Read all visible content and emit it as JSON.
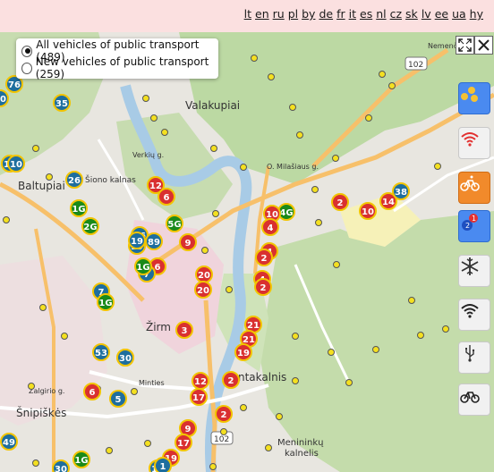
{
  "languages": [
    "lt",
    "en",
    "ru",
    "pl",
    "by",
    "de",
    "fr",
    "it",
    "es",
    "nl",
    "cz",
    "sk",
    "lv",
    "ee",
    "ua",
    "hy"
  ],
  "filters": {
    "all_label": "All vehicles of public transport (489)",
    "new_label": "New vehicles of public transport (259)",
    "selected": "all"
  },
  "map_labels": {
    "valakupiai": "Valakupiai",
    "baltupiai": "Baltupiai",
    "siono_kalnas": "Šiono kalnas",
    "zirmunai": "Žirm",
    "antakalnis": "ntakalnis",
    "snipiskes": "Šnipiškės",
    "menininku_1": "Menininkų",
    "menininku_2": "kalnelis",
    "zalgirio": "Žalgirio g.",
    "mintes": "Minties",
    "o_milasiaus": "O. Milašiaus g.",
    "road_102_a": "102",
    "road_102_b": "102",
    "nemenc": "Nemenč",
    "verkiu": "Verkių g."
  },
  "side_buttons": [
    {
      "name": "routes-button",
      "icon": "routes-icon",
      "style": "blue"
    },
    {
      "name": "wifi-buses-button",
      "icon": "wifi-red-icon",
      "style": "plain"
    },
    {
      "name": "bike-racks-button",
      "icon": "bicycle-icon",
      "style": "orange"
    },
    {
      "name": "stops-numbers-button",
      "icon": "numbers-icon",
      "style": "blue"
    },
    {
      "name": "air-conditioning-button",
      "icon": "snowflake-icon",
      "style": "plain"
    },
    {
      "name": "wifi-button",
      "icon": "wifi-icon",
      "style": "plain"
    },
    {
      "name": "usb-button",
      "icon": "usb-icon",
      "style": "plain"
    },
    {
      "name": "bicycle-transport-button",
      "icon": "bicycle-icon",
      "style": "plain"
    }
  ],
  "vehicles": [
    {
      "label": "76",
      "color": "#1e6e9e"
    },
    {
      "label": "35",
      "color": "#1e6e9e"
    },
    {
      "label": "10",
      "color": "#1e6e9e"
    },
    {
      "label": "26",
      "color": "#1e6e9e"
    },
    {
      "label": "1G",
      "color": "#1a8a1a"
    },
    {
      "label": "2G",
      "color": "#1a8a1a"
    },
    {
      "label": "19",
      "color": "#1e6e9e"
    },
    {
      "label": "66",
      "color": "#1e6e9e"
    },
    {
      "label": "89",
      "color": "#1e6e9e"
    },
    {
      "label": "5G",
      "color": "#1a8a1a"
    },
    {
      "label": "12",
      "color": "#d93030"
    },
    {
      "label": "6",
      "color": "#d93030"
    },
    {
      "label": "9",
      "color": "#d93030"
    },
    {
      "label": "6",
      "color": "#d93030"
    },
    {
      "label": "7",
      "color": "#1e6e9e"
    },
    {
      "label": "1G",
      "color": "#1a8a1a"
    },
    {
      "label": "20",
      "color": "#d93030"
    },
    {
      "label": "20",
      "color": "#d93030"
    },
    {
      "label": "7",
      "color": "#1e6e9e"
    },
    {
      "label": "1G",
      "color": "#1a8a1a"
    },
    {
      "label": "30",
      "color": "#1e6e9e"
    },
    {
      "label": "3",
      "color": "#d93030"
    },
    {
      "label": "53",
      "color": "#1e6e9e"
    },
    {
      "label": "30",
      "color": "#1e6e9e"
    },
    {
      "label": "10",
      "color": "#1e6e9e"
    },
    {
      "label": "6",
      "color": "#d93030"
    },
    {
      "label": "5",
      "color": "#1e6e9e"
    },
    {
      "label": "4G",
      "color": "#1a8a1a"
    },
    {
      "label": "10",
      "color": "#d93030"
    },
    {
      "label": "4",
      "color": "#d93030"
    },
    {
      "label": "4",
      "color": "#d93030"
    },
    {
      "label": "2",
      "color": "#d93030"
    },
    {
      "label": "4",
      "color": "#d93030"
    },
    {
      "label": "21",
      "color": "#d93030"
    },
    {
      "label": "21",
      "color": "#d93030"
    },
    {
      "label": "19",
      "color": "#d93030"
    },
    {
      "label": "12",
      "color": "#d93030"
    },
    {
      "label": "17",
      "color": "#d93030"
    },
    {
      "label": "2",
      "color": "#d93030"
    },
    {
      "label": "2",
      "color": "#d93030"
    },
    {
      "label": "9",
      "color": "#d93030"
    },
    {
      "label": "17",
      "color": "#d93030"
    },
    {
      "label": "19",
      "color": "#d93030"
    },
    {
      "label": "14",
      "color": "#1e6e9e"
    },
    {
      "label": "2",
      "color": "#d93030"
    },
    {
      "label": "10",
      "color": "#d93030"
    },
    {
      "label": "14",
      "color": "#d93030"
    },
    {
      "label": "38",
      "color": "#1e6e9e"
    },
    {
      "label": "2",
      "color": "#d93030"
    },
    {
      "label": "49",
      "color": "#1e6e9e"
    },
    {
      "label": "1G",
      "color": "#1a8a1a"
    },
    {
      "label": "30",
      "color": "#1e6e9e"
    },
    {
      "label": "1",
      "color": "#1e6e9e"
    },
    {
      "label": "10",
      "color": "#1e6e9e"
    },
    {
      "label": "19",
      "color": "#1e6e9e"
    }
  ]
}
